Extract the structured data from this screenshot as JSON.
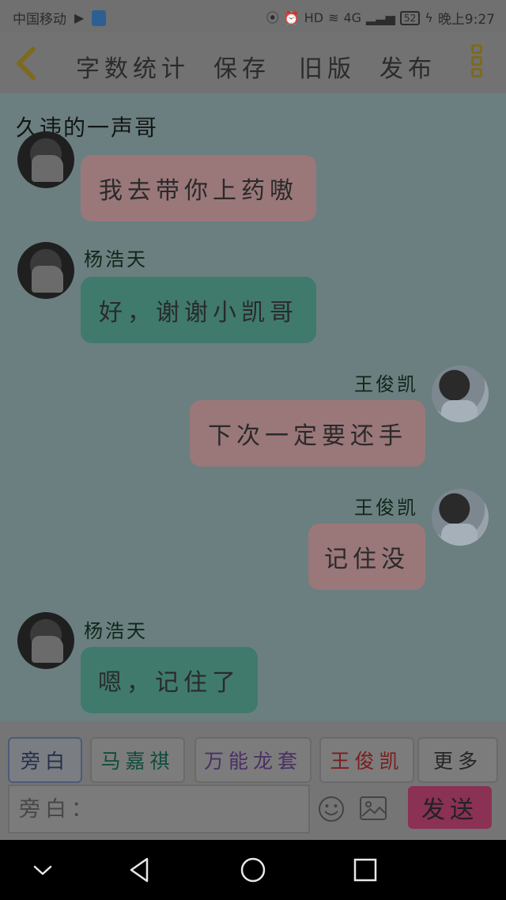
{
  "status_bar": {
    "carrier": "中国移动",
    "network": "4G",
    "battery": "52",
    "time": "晚上9:27",
    "hd": "HD"
  },
  "toolbar": {
    "word_count": "字数统计",
    "save": "保存",
    "old_version": "旧版",
    "publish": "发布"
  },
  "chat": {
    "title": "久违的一声哥",
    "messages": [
      {
        "speaker": "",
        "text": "我去带你上药嗷",
        "side": "left",
        "color": "pink"
      },
      {
        "speaker": "杨浩天",
        "text": "好，谢谢小凯哥",
        "side": "left",
        "color": "green"
      },
      {
        "speaker": "王俊凯",
        "text": "下次一定要还手",
        "side": "right",
        "color": "pink"
      },
      {
        "speaker": "王俊凯",
        "text": "记住没",
        "side": "right",
        "color": "pink"
      },
      {
        "speaker": "杨浩天",
        "text": "嗯，记住了",
        "side": "left",
        "color": "green"
      }
    ]
  },
  "roles": [
    {
      "label": "旁白",
      "color": "#23304a"
    },
    {
      "label": "马嘉祺",
      "color": "#0e4c3b"
    },
    {
      "label": "万能龙套",
      "color": "#4a2f66"
    },
    {
      "label": "王俊凯",
      "color": "#7c1d1d"
    },
    {
      "label": "更多",
      "color": "#262626"
    }
  ],
  "input": {
    "placeholder": "旁白："
  },
  "send_label": "发送"
}
